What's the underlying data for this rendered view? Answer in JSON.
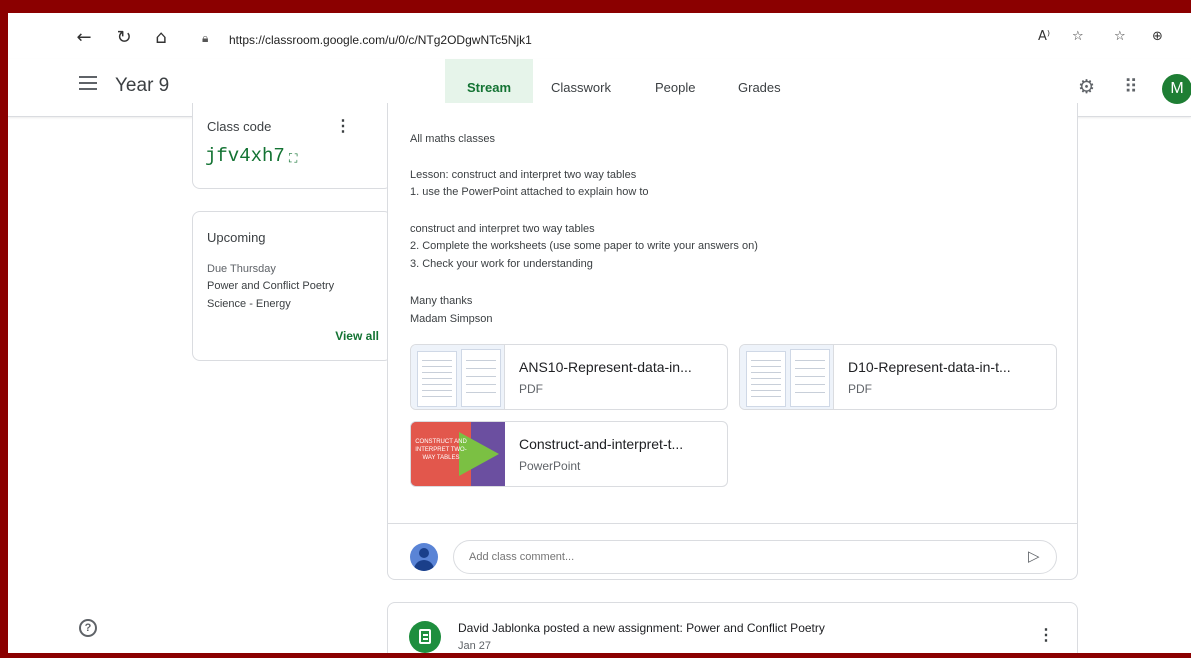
{
  "browser": {
    "url": "https://classroom.google.com/u/0/c/NTg2ODgwNTc5Njk1",
    "back_icon": "back-arrow-icon",
    "reload_icon": "reload-icon",
    "home_icon": "home-icon",
    "read_aloud_label": "A⁾"
  },
  "header": {
    "class_title": "Year 9",
    "tabs": [
      {
        "label": "Stream",
        "active": true
      },
      {
        "label": "Classwork",
        "active": false
      },
      {
        "label": "People",
        "active": false
      },
      {
        "label": "Grades",
        "active": false
      }
    ],
    "avatar_letter": "M"
  },
  "class_code": {
    "label": "Class code",
    "value": "jfv4xh7"
  },
  "upcoming": {
    "title": "Upcoming",
    "due": "Due Thursday",
    "items": [
      "Power and Conflict Poetry",
      "Science - Energy"
    ],
    "view_all": "View all"
  },
  "post": {
    "lines": [
      "All maths classes",
      "Lesson: construct and interpret two way tables",
      "1. use the PowerPoint attached to explain how to",
      "construct and interpret two way tables",
      "2. Complete the worksheets (use some paper to write your answers on)",
      "3. Check your work for understanding",
      "Many thanks",
      "Madam Simpson"
    ],
    "attachments": [
      {
        "name": "ANS10-Represent-data-in...",
        "type": "PDF"
      },
      {
        "name": "D10-Represent-data-in-t...",
        "type": "PDF"
      },
      {
        "name": "Construct-and-interpret-t...",
        "type": "PowerPoint"
      }
    ],
    "ppt_thumb_text": "CONSTRUCT AND INTERPRET TWO-WAY TABLES",
    "comment_placeholder": "Add class comment..."
  },
  "next_post": {
    "title": "David Jablonka posted a new assignment: Power and Conflict Poetry",
    "date": "Jan 27"
  },
  "colors": {
    "accent_green": "#137333",
    "frame_border": "#8b0000"
  }
}
